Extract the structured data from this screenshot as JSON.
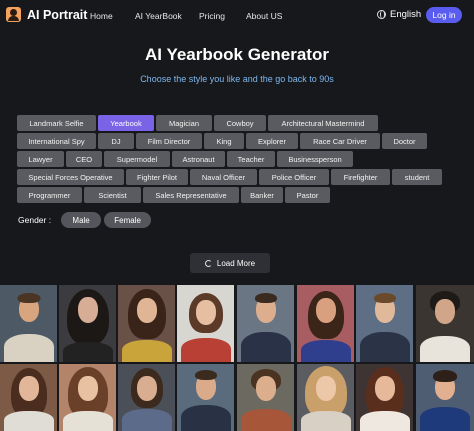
{
  "nav": {
    "logo_text": "AI Portrait",
    "links": [
      "Home",
      "AI YearBook",
      "Pricing",
      "About US"
    ],
    "language": "English",
    "login": "Log in"
  },
  "hero": {
    "title": "AI Yearbook Generator",
    "subtitle": "Choose the style you like and the go back to 90s"
  },
  "styles": {
    "selected": "Yearbook",
    "rows": [
      [
        "Landmark Selfie",
        "Yearbook",
        "Magician",
        "Cowboy",
        "Architectural Mastermind"
      ],
      [
        "International Spy",
        "DJ",
        "Film Director",
        "King",
        "Explorer",
        "Race Car Driver",
        "Doctor"
      ],
      [
        "Lawyer",
        "CEO",
        "Supermodel",
        "Astronaut",
        "Teacher",
        "Businessperson"
      ],
      [
        "Special Forces Operative",
        "Fighter Pilot",
        "Naval Officer",
        "Police Officer",
        "Firefighter",
        "student"
      ],
      [
        "Programmer",
        "Scientist",
        "Sales Representative",
        "Banker",
        "Pastor"
      ]
    ]
  },
  "gender": {
    "label": "Gender :",
    "options": [
      "Male",
      "Female"
    ]
  },
  "load_more": "Load More",
  "colors": {
    "accent": "#5a5cf0",
    "active_tag": "#7b63e8",
    "subtitle": "#7db7f0",
    "tag_bg": "#595b60",
    "page_bg": "#17181b"
  }
}
